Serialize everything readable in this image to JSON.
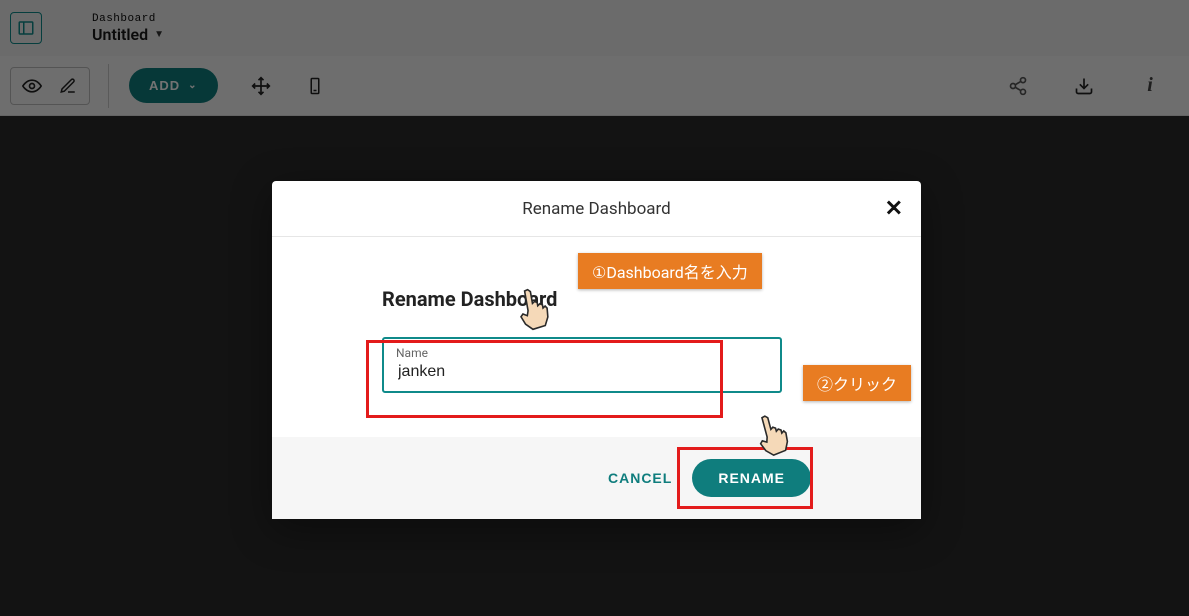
{
  "header": {
    "breadcrumb": "Dashboard",
    "title": "Untitled"
  },
  "toolbar": {
    "add_label": "ADD"
  },
  "modal": {
    "title": "Rename Dashboard",
    "body_heading": "Rename Dashboard",
    "field_label": "Name",
    "field_value": "janken",
    "cancel_label": "CANCEL",
    "rename_label": "RENAME"
  },
  "annotations": {
    "step1": "①Dashboard名を入力",
    "step2": "②クリック"
  }
}
